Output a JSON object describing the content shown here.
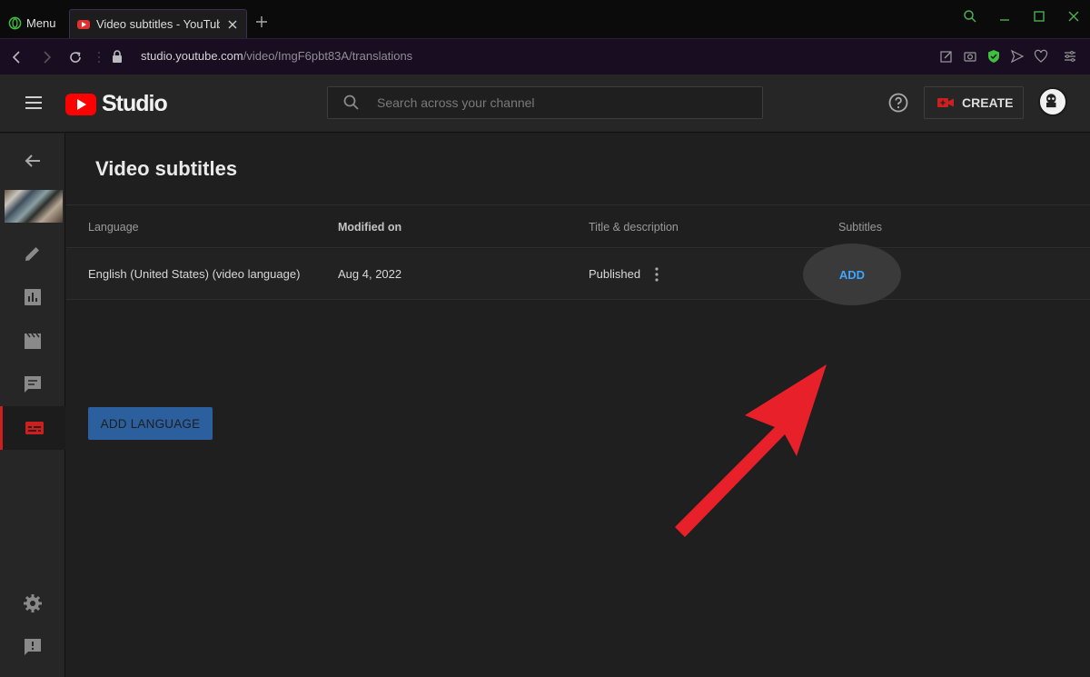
{
  "browser": {
    "menu_label": "Menu",
    "tab_title": "Video subtitles - YouTube Studio",
    "url_host": "studio.youtube.com",
    "url_path": "/video/ImgF6pbt83A/translations"
  },
  "header": {
    "logo_text": "Studio",
    "search_placeholder": "Search across your channel",
    "create_label": "CREATE"
  },
  "page": {
    "title": "Video subtitles"
  },
  "table": {
    "headers": [
      "Language",
      "Modified on",
      "Title & description",
      "Subtitles"
    ],
    "rows": [
      {
        "language": "English (United States) (video language)",
        "modified": "Aug 4, 2022",
        "title_status": "Published",
        "subtitles_action": "ADD"
      }
    ]
  },
  "actions": {
    "add_language": "ADD LANGUAGE"
  },
  "colors": {
    "accent_link": "#3ea6ff",
    "brand_red": "#ff0000",
    "annotation_arrow": "#e8202a",
    "primary_button": "#2b5f9e"
  }
}
